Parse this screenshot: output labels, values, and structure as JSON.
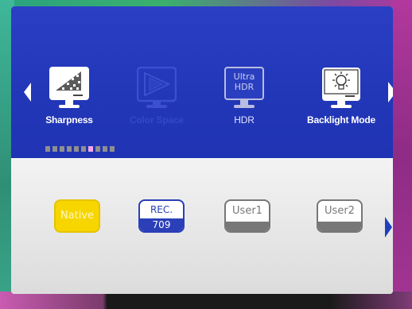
{
  "osd": {
    "menu_items": [
      {
        "label": "Sharpness",
        "icon": "sharpness-icon",
        "state": "normal"
      },
      {
        "label": "Color Space",
        "icon": "color-space-icon",
        "state": "selected"
      },
      {
        "label": "HDR",
        "icon": "ultra-hdr-icon",
        "state": "normal",
        "icon_text": [
          "Ultra",
          "HDR"
        ]
      },
      {
        "label": "Backlight Mode",
        "icon": "backlight-bulb-icon",
        "state": "normal"
      }
    ],
    "page_indicator": {
      "total": 10,
      "active_index": 6
    },
    "options": [
      {
        "label": "Native",
        "state": "selected"
      },
      {
        "label_top": "REC.",
        "label_bottom": "709",
        "state": "normal"
      },
      {
        "label": "User1",
        "state": "normal"
      },
      {
        "label": "User2",
        "state": "normal"
      }
    ]
  },
  "colors": {
    "panel_blue": "#2236b8",
    "selected_yellow": "#f7d600",
    "indicator_active": "#f1a8e6"
  }
}
